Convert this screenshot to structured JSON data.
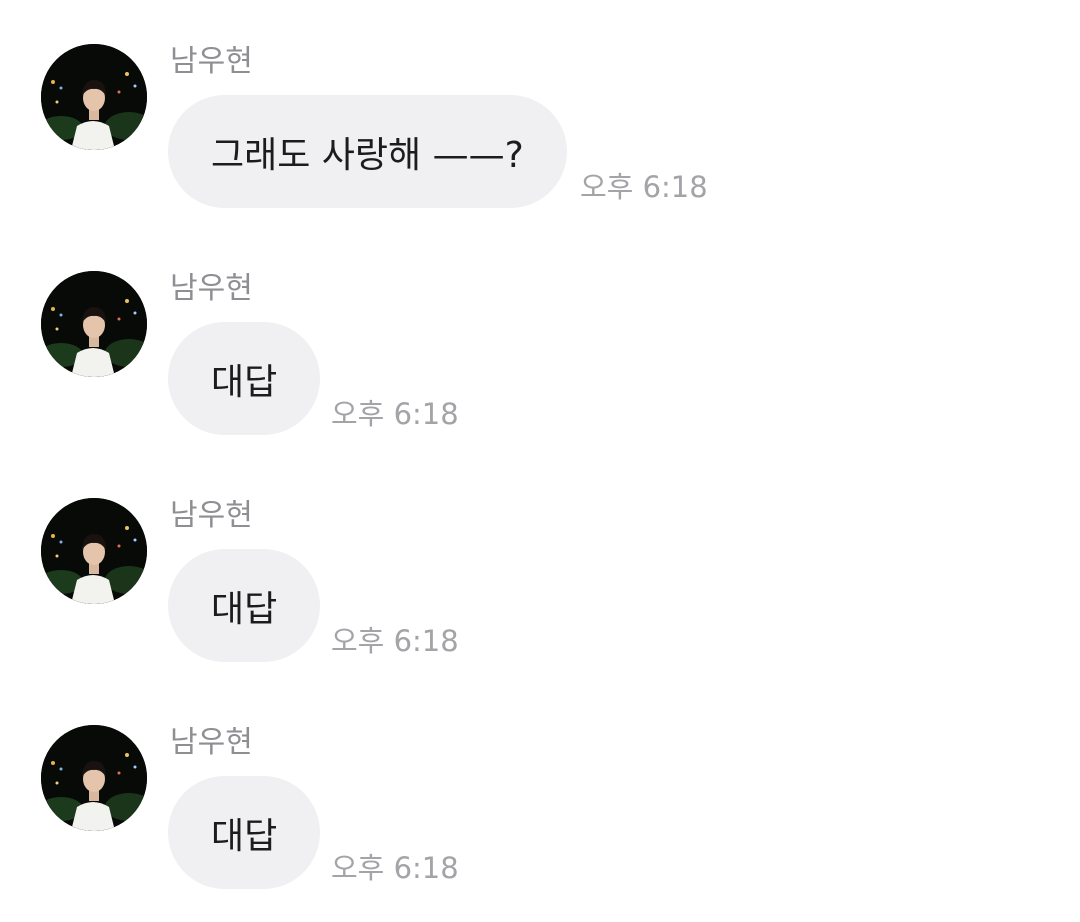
{
  "messages": [
    {
      "sender": "남우현",
      "text": "그래도 사랑해 ——?",
      "time": "오후 6:18",
      "avatar_icon": "profile-photo"
    },
    {
      "sender": "남우현",
      "text": "대답",
      "time": "오후 6:18",
      "avatar_icon": "profile-photo"
    },
    {
      "sender": "남우현",
      "text": "대답",
      "time": "오후 6:18",
      "avatar_icon": "profile-photo"
    },
    {
      "sender": "남우현",
      "text": "대답",
      "time": "오후 6:18",
      "avatar_icon": "profile-photo"
    }
  ],
  "colors": {
    "bubble_bg": "#f0f0f2",
    "sender_text": "#8e8e93",
    "time_text": "#a4a4a8",
    "message_text": "#1c1c1e"
  }
}
